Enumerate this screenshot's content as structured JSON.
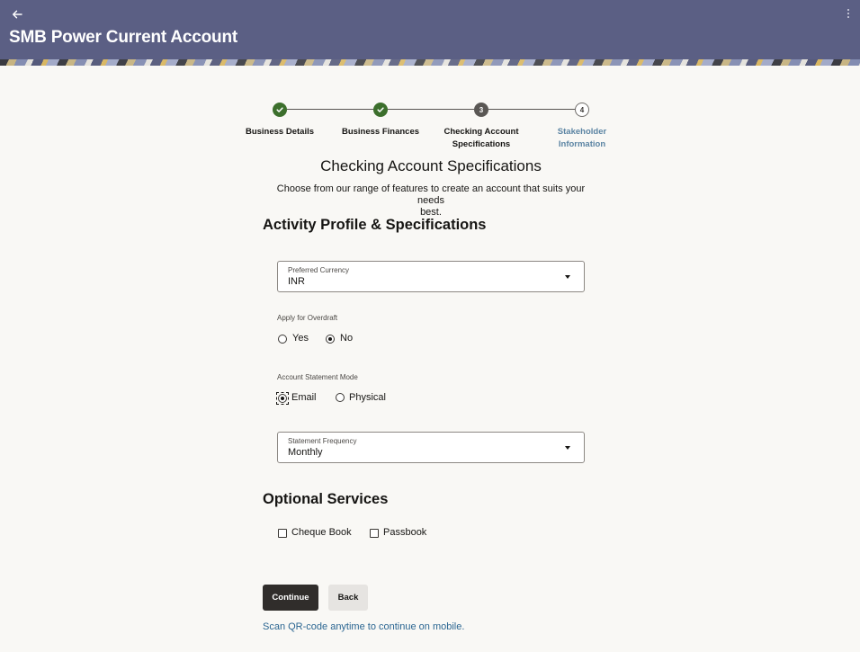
{
  "header": {
    "title": "SMB Power Current Account",
    "back_icon": "arrow-left-icon",
    "menu_icon": "kebab-menu-icon",
    "background_color": "#5b5f84"
  },
  "stepper": {
    "steps": [
      {
        "label_line1": "Business Details",
        "label_line2": "",
        "status": "completed",
        "number": "1"
      },
      {
        "label_line1": "Business Finances",
        "label_line2": "",
        "status": "completed",
        "number": "2"
      },
      {
        "label_line1": "Checking Account",
        "label_line2": "Specifications",
        "status": "current",
        "number": "3"
      },
      {
        "label_line1": "Stakeholder",
        "label_line2": "Information",
        "status": "upcoming",
        "number": "4"
      }
    ],
    "completed_color": "#3c6f2c",
    "upcoming_label_color": "#5b84a3"
  },
  "page": {
    "heading": "Checking Account Specifications",
    "subtitle_line1": "Choose from our range of features to create an account that suits your needs",
    "subtitle_line2": "best."
  },
  "activity": {
    "section_title": "Activity Profile & Specifications",
    "preferred_currency": {
      "label": "Preferred Currency",
      "value": "INR"
    },
    "overdraft": {
      "label": "Apply for Overdraft",
      "options": [
        {
          "label": "Yes",
          "selected": false
        },
        {
          "label": "No",
          "selected": true
        }
      ]
    },
    "statement_mode": {
      "label": "Account Statement Mode",
      "options": [
        {
          "label": "Email",
          "selected": true
        },
        {
          "label": "Physical",
          "selected": false
        }
      ]
    },
    "statement_frequency": {
      "label": "Statement Frequency",
      "value": "Monthly"
    }
  },
  "optional_services": {
    "section_title": "Optional Services",
    "items": [
      {
        "label": "Cheque Book",
        "checked": false
      },
      {
        "label": "Passbook",
        "checked": false
      }
    ]
  },
  "actions": {
    "continue_label": "Continue",
    "back_label": "Back",
    "qr_link": "Scan QR-code anytime to continue on mobile."
  }
}
